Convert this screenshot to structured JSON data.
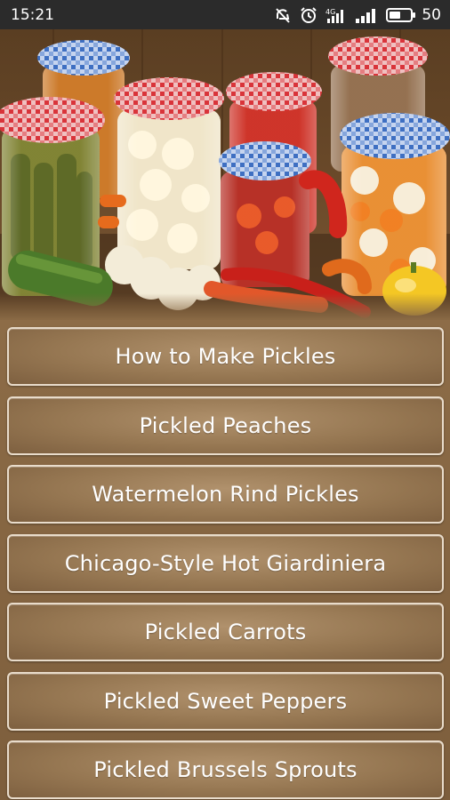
{
  "status_bar": {
    "time": "15:21",
    "battery_level": "50",
    "icons": [
      "mute-icon",
      "alarm-icon",
      "mobile-data-icon",
      "signal-icon",
      "battery-icon"
    ]
  },
  "header": {
    "image_alt": "jars of pickled vegetables"
  },
  "menu": {
    "items": [
      {
        "label": "How to Make Pickles"
      },
      {
        "label": "Pickled Peaches"
      },
      {
        "label": "Watermelon Rind Pickles"
      },
      {
        "label": "Chicago-Style Hot Giardiniera"
      },
      {
        "label": "Pickled Carrots"
      },
      {
        "label": "Pickled Sweet Peppers"
      },
      {
        "label": "Pickled Brussels Sprouts"
      }
    ]
  },
  "colors": {
    "background": "#8a6a45",
    "button_border": "#e9dccb",
    "status_bar": "#2b2b2b"
  }
}
